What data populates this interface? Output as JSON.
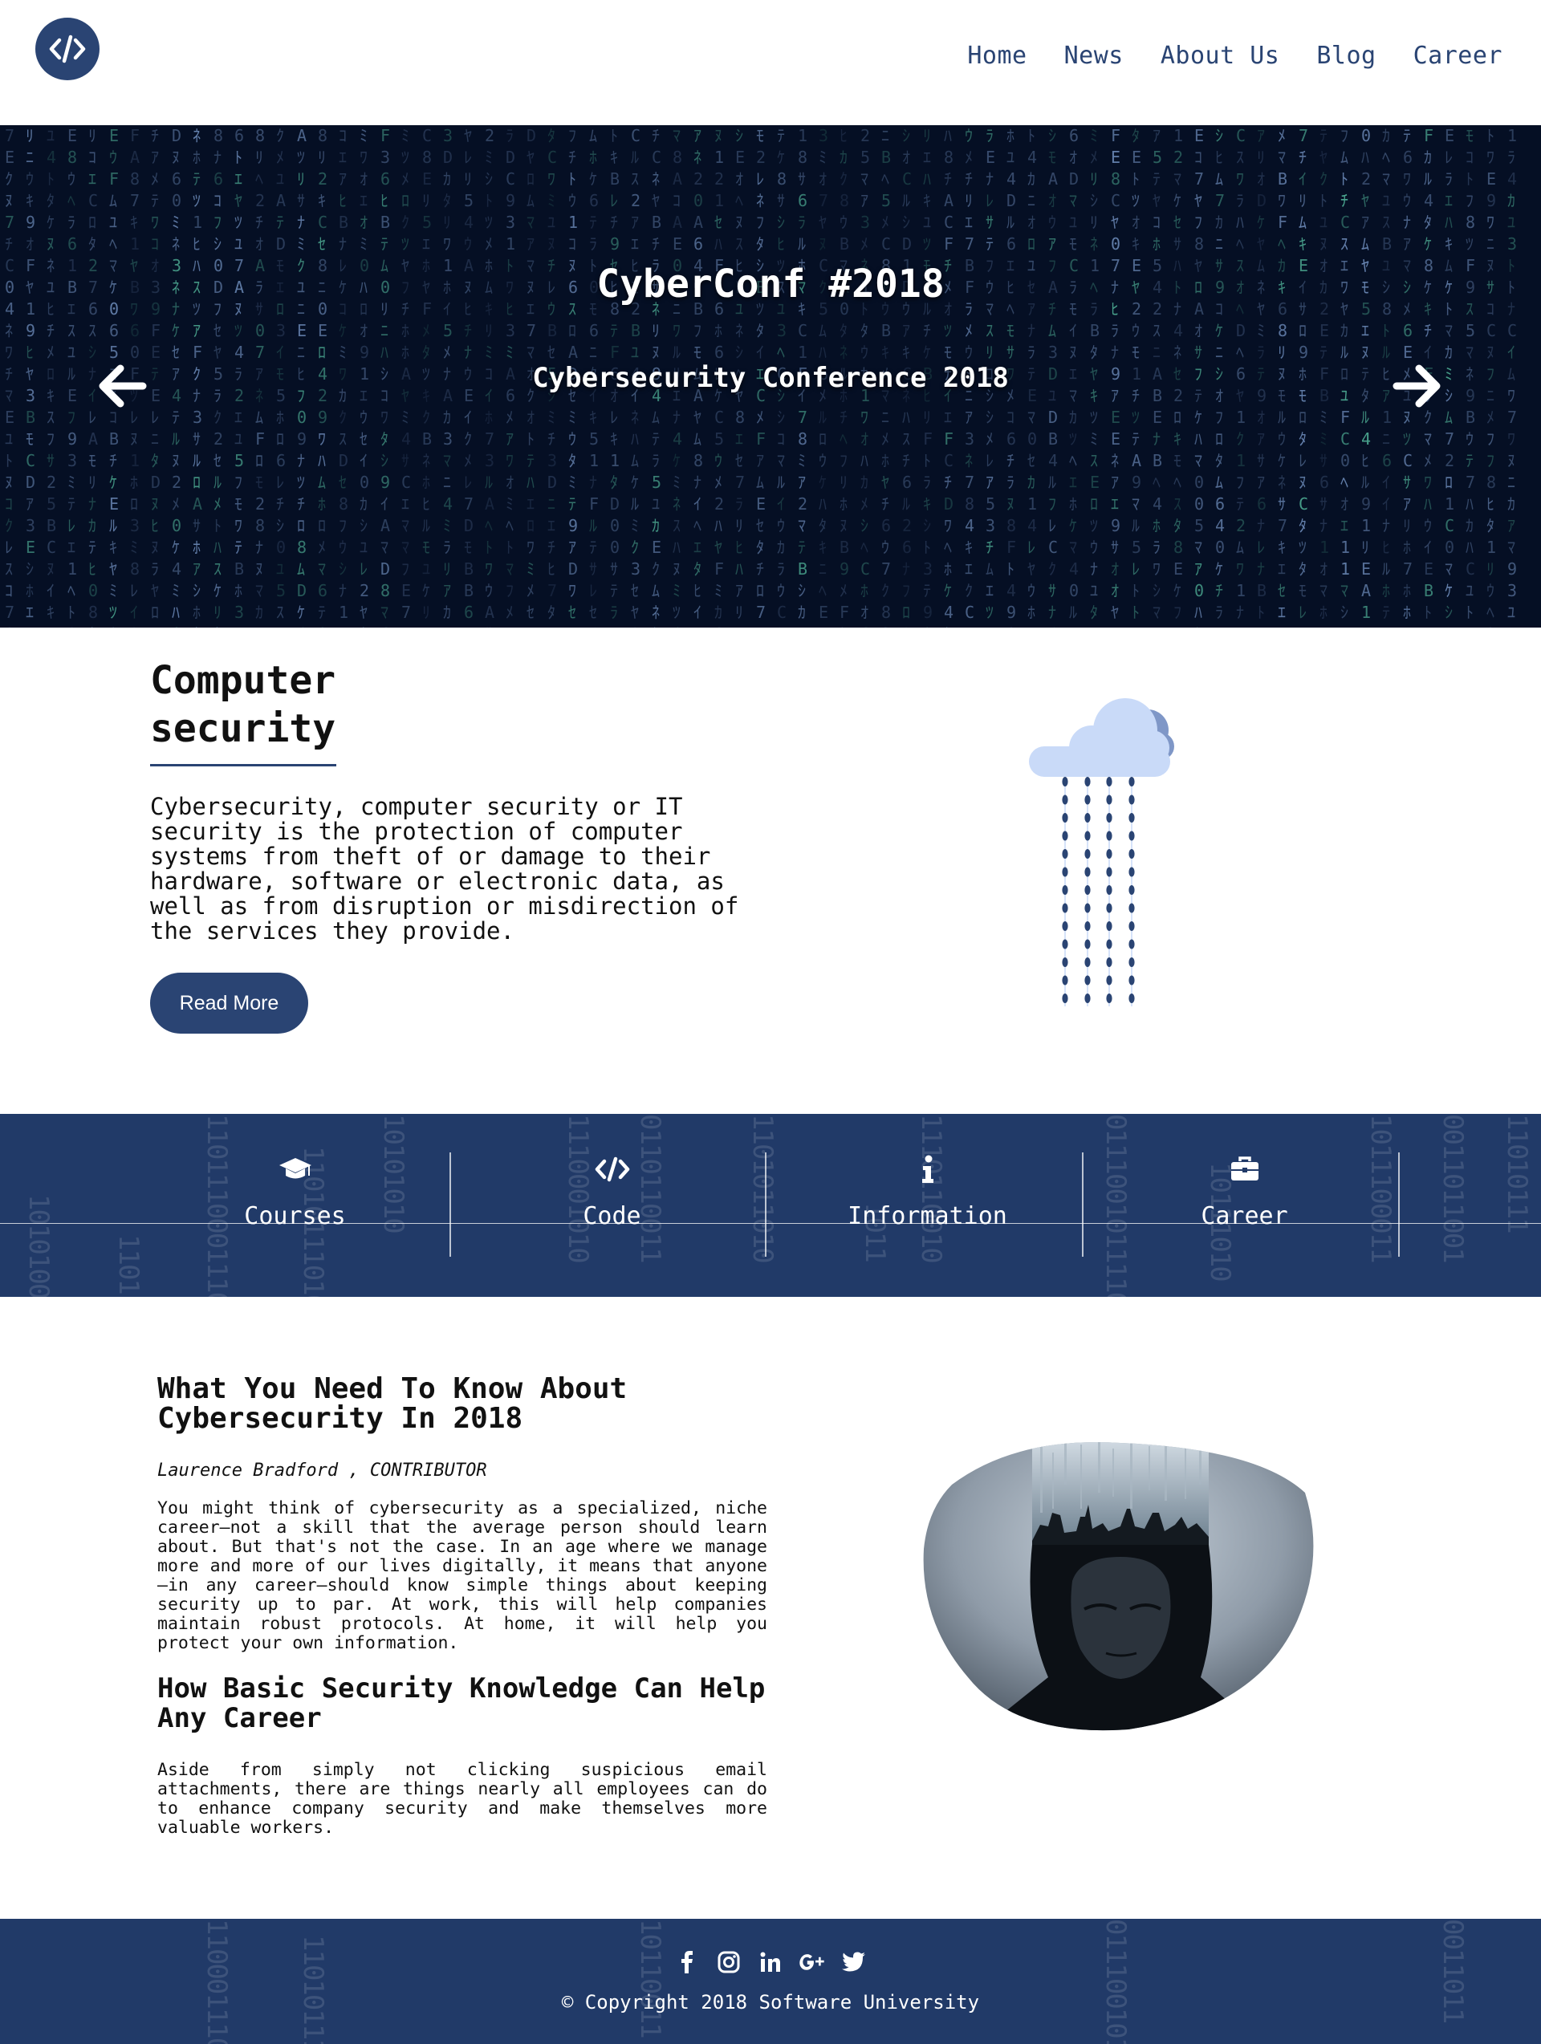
{
  "brand": {
    "logo_icon": "code-icon",
    "accent": "#2a4473"
  },
  "nav": {
    "items": [
      "Home",
      "News",
      "About Us",
      "Blog",
      "Career"
    ]
  },
  "hero": {
    "title": "CyberConf #2018",
    "subtitle": "Cybersecurity Conference 2018",
    "prev_icon": "arrow-left-icon",
    "next_icon": "arrow-right-icon"
  },
  "intro": {
    "title": "Computer security",
    "text": "Cybersecurity, computer security or IT security is the protection of computer systems from theft of or damage to their hardware, software or electronic data, as well as from disruption or misdirection of the services they provide.",
    "button": "Read More",
    "illustration": "cloud-rain-icon"
  },
  "categories": [
    {
      "label": "Courses",
      "icon": "graduation-cap-icon"
    },
    {
      "label": "Code",
      "icon": "code-icon"
    },
    {
      "label": "Information",
      "icon": "info-icon"
    },
    {
      "label": "Career",
      "icon": "briefcase-icon"
    }
  ],
  "article": {
    "heading1": "What You Need To Know About Cybersecurity In 2018",
    "author": "Laurence Bradford",
    "author_role": "CONTRIBUTOR",
    "paragraph1": "You might think of cybersecurity as a specialized, niche career—not a skill that the average person should learn about. But that's not the case. In an age where we manage more and more of our lives digitally, it means that anyone—in any career—should know simple things about keeping security up to par. At work, this will help companies maintain robust protocols. At home, it will help you protect your own information.",
    "heading2": "How Basic Security Knowledge Can Help Any Career",
    "paragraph2": "Aside from simply not clicking suspicious email attachments, there are things nearly all employees can do to enhance company security and make themselves more valuable workers."
  },
  "footer": {
    "social": [
      "facebook-icon",
      "instagram-icon",
      "linkedin-icon",
      "google-plus-icon",
      "twitter-icon"
    ],
    "copyright": "© Copyright 2018 Software University"
  }
}
